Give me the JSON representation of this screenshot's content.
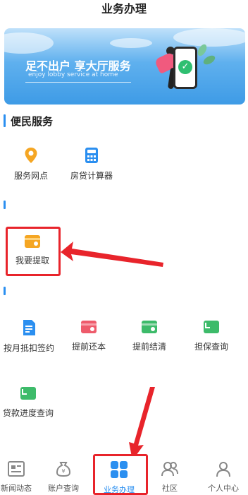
{
  "header": {
    "title": "业务办理"
  },
  "banner": {
    "slogan": "足不出户 享大厅服务",
    "slogan_en": "enjoy lobby service at home"
  },
  "sections": [
    {
      "title": "便民服务",
      "items": [
        {
          "label": "服务网点",
          "icon": "location-pin-icon",
          "color": "#f5a623"
        },
        {
          "label": "房贷计算器",
          "icon": "calculator-icon",
          "color": "#2b8ff0"
        }
      ]
    },
    {
      "title": "",
      "items": [
        {
          "label": "我要提取",
          "icon": "wallet-icon",
          "color": "#f5a623"
        }
      ]
    },
    {
      "title": "",
      "items": [
        {
          "label": "按月抵扣签约",
          "icon": "document-icon",
          "color": "#2b8ff0"
        },
        {
          "label": "提前还本",
          "icon": "card-red-icon",
          "color": "#ee5b6b"
        },
        {
          "label": "提前结清",
          "icon": "card-green-icon",
          "color": "#3dbb6a"
        },
        {
          "label": "担保查询",
          "icon": "card-green-icon",
          "color": "#3dbb6a"
        },
        {
          "label": "贷款进度查询",
          "icon": "card-green-icon",
          "color": "#3dbb6a"
        }
      ]
    }
  ],
  "tabbar": {
    "active": "业务办理",
    "tabs": [
      {
        "label": "新闻动态",
        "icon": "news-icon"
      },
      {
        "label": "账户查询",
        "icon": "money-bag-icon"
      },
      {
        "label": "业务办理",
        "icon": "grid-icon"
      },
      {
        "label": "社区",
        "icon": "community-icon"
      },
      {
        "label": "个人中心",
        "icon": "user-icon"
      }
    ]
  },
  "colors": {
    "accent": "#2b8ff0",
    "annotation": "#e8242b"
  }
}
